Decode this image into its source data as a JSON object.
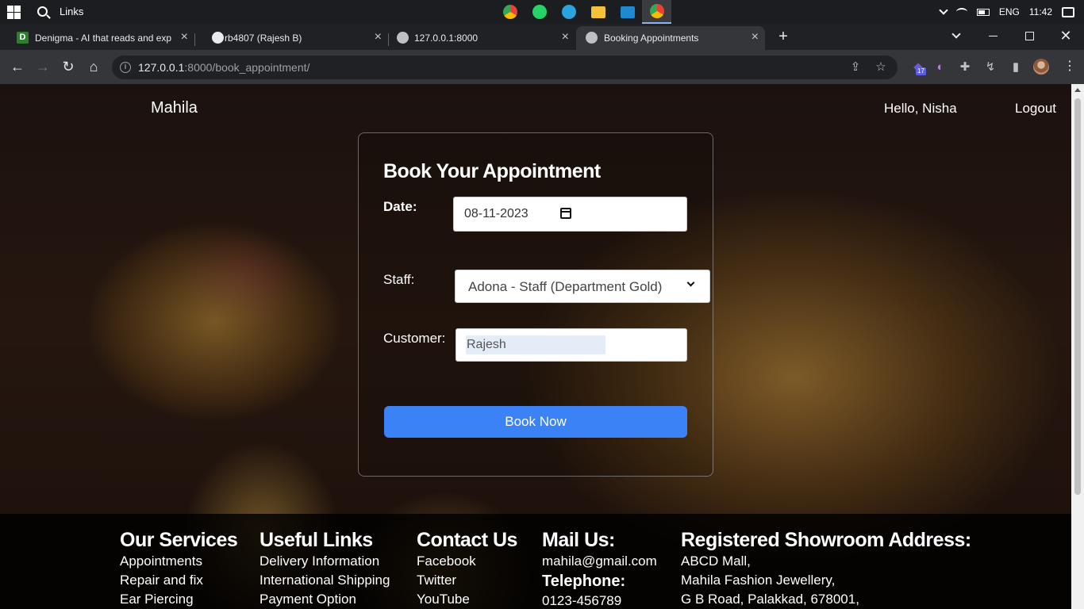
{
  "taskbar": {
    "search_text": "Links",
    "language": "ENG",
    "time": "11:42"
  },
  "tabs": [
    {
      "title": "Denigma - AI that reads and exp",
      "favicon": "D"
    },
    {
      "title": "rb4807 (Rajesh B)"
    },
    {
      "title": "127.0.0.1:8000"
    },
    {
      "title": "Booking Appointments"
    }
  ],
  "address": {
    "host": "127.0.0.1",
    "rest": ":8000/book_appointment/"
  },
  "extensions": {
    "badge": "17"
  },
  "nav": {
    "brand": "Mahila",
    "greeting": "Hello, Nisha",
    "logout": "Logout"
  },
  "form": {
    "title": "Book Your Appointment",
    "date_label": "Date:",
    "date_value": "08-11-2023",
    "staff_label": "Staff:",
    "staff_value": "Adona - Staff (Department Gold)",
    "customer_label": "Customer:",
    "customer_value": "Rajesh",
    "submit_label": "Book Now"
  },
  "footer": {
    "services": {
      "title": "Our Services",
      "items": [
        "Appointments",
        "Repair and fix",
        "Ear Piercing"
      ]
    },
    "links": {
      "title": "Useful Links",
      "items": [
        "Delivery Information",
        "International Shipping",
        "Payment Option"
      ]
    },
    "contact": {
      "title": "Contact Us",
      "items": [
        "Facebook",
        "Twitter",
        "YouTube"
      ]
    },
    "mail": {
      "title": "Mail Us:",
      "email": "mahila@gmail.com",
      "phone_title": "Telephone:",
      "phone": "0123-456789"
    },
    "address": {
      "title": "Registered Showroom Address:",
      "lines": [
        "ABCD Mall,",
        "Mahila Fashion Jewellery,",
        "G B Road, Palakkad, 678001,"
      ]
    }
  },
  "colors": {
    "accent_button": "#3b82f6",
    "tab_strip": "#202124",
    "toolbar": "#35363a"
  }
}
